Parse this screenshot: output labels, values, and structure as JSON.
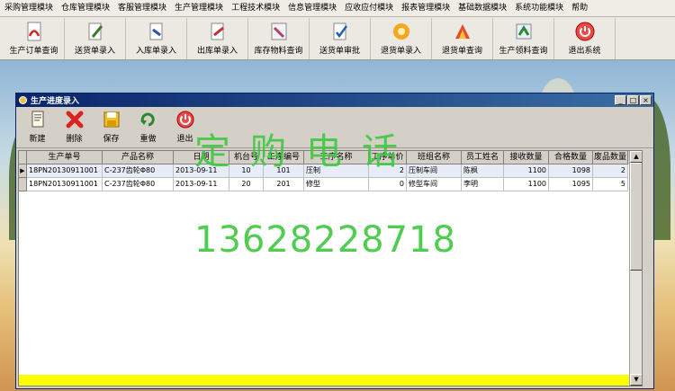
{
  "menu": [
    "采购管理模块",
    "仓库管理模块",
    "客服管理模块",
    "生产管理模块",
    "工程技术模块",
    "信息管理模块",
    "应收应付模块",
    "报表管理模块",
    "基础数据模块",
    "系统功能模块",
    "帮助"
  ],
  "toolbar": [
    {
      "label": "生产订单查询",
      "icon": "pdf-icon"
    },
    {
      "label": "送货单录入",
      "icon": "document-edit-icon"
    },
    {
      "label": "入库单录入",
      "icon": "document-in-icon"
    },
    {
      "label": "出库单录入",
      "icon": "document-out-icon"
    },
    {
      "label": "库存物料查询",
      "icon": "inventory-icon"
    },
    {
      "label": "送货单审批",
      "icon": "approve-icon"
    },
    {
      "label": "退货单录入",
      "icon": "return-icon"
    },
    {
      "label": "退货单查询",
      "icon": "return-search-icon"
    },
    {
      "label": "生产领料查询",
      "icon": "material-icon"
    },
    {
      "label": "退出系统",
      "icon": "power-icon"
    }
  ],
  "window": {
    "title": "生产进度录入",
    "controls": [
      "_",
      "□",
      "×"
    ],
    "tools": [
      {
        "label": "新建",
        "icon": "new-icon"
      },
      {
        "label": "删除",
        "icon": "delete-icon"
      },
      {
        "label": "保存",
        "icon": "save-icon"
      },
      {
        "label": "重做",
        "icon": "redo-icon"
      },
      {
        "label": "退出",
        "icon": "exit-icon"
      }
    ]
  },
  "grid": {
    "columns": [
      "生产单号",
      "产品名称",
      "日期",
      "机台号",
      "工序编号",
      "工序名称",
      "工序单价",
      "班组名称",
      "员工姓名",
      "接收数量",
      "合格数量",
      "废品数量"
    ],
    "rows": [
      [
        "18PN20130911001",
        "C-237齿轮Φ80",
        "2013-09-11",
        "10",
        "101",
        "压制",
        "2",
        "压制车间",
        "陈枫",
        "1100",
        "1098",
        "2"
      ],
      [
        "18PN20130911001",
        "C-237齿轮Φ80",
        "2013-09-11",
        "20",
        "201",
        "修型",
        "0",
        "修型车间",
        "李明",
        "1100",
        "1095",
        "5"
      ]
    ],
    "selected_row_marker": "▶"
  },
  "watermark": {
    "line1": "定购电话",
    "line2": "13628228718"
  },
  "colors": {
    "watermark": "#3ec83e",
    "footer_bar": "#ffff00",
    "titlebar": "#0a246a"
  }
}
